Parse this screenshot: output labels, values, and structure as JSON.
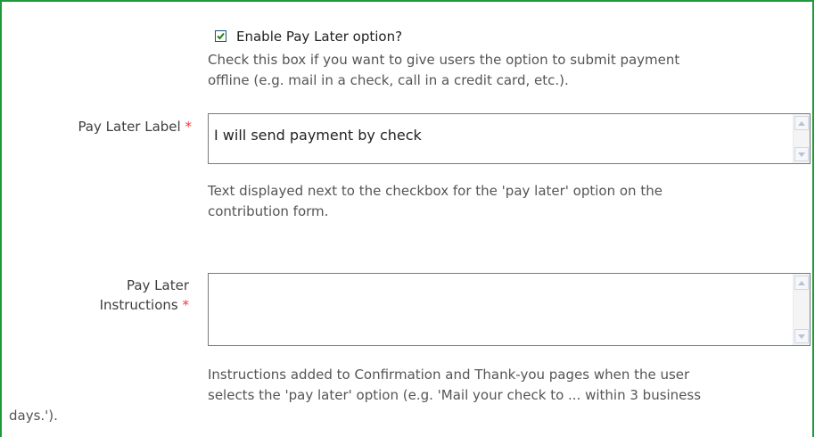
{
  "enable_pay_later": {
    "checked": true,
    "label": "Enable Pay Later option?",
    "help_line1": "Check this box if you want to give users the option to submit payment",
    "help_line2": "offline (e.g. mail in a check, call in a credit card, etc.)."
  },
  "pay_later_label": {
    "label": "Pay Later Label",
    "required_marker": "*",
    "value": "I will send payment by check",
    "help_line1": "Text displayed next to the checkbox for the 'pay later' option on the",
    "help_line2": "contribution form."
  },
  "pay_later_instructions": {
    "label_line1": "Pay Later",
    "label_line2": "Instructions",
    "required_marker": "*",
    "value": "",
    "help_line1": "Instructions added to Confirmation and Thank-you pages when the user",
    "help_line2": "selects the 'pay later' option (e.g. 'Mail your check to ... within 3 business",
    "help_line3": "days.')."
  },
  "colors": {
    "frame_border": "#1e9a3c",
    "required": "#ff3333",
    "checkmark": "#1e7f1e"
  },
  "icons": {
    "scroll_up": "triangle-up",
    "scroll_down": "triangle-down",
    "checkmark": "check"
  }
}
